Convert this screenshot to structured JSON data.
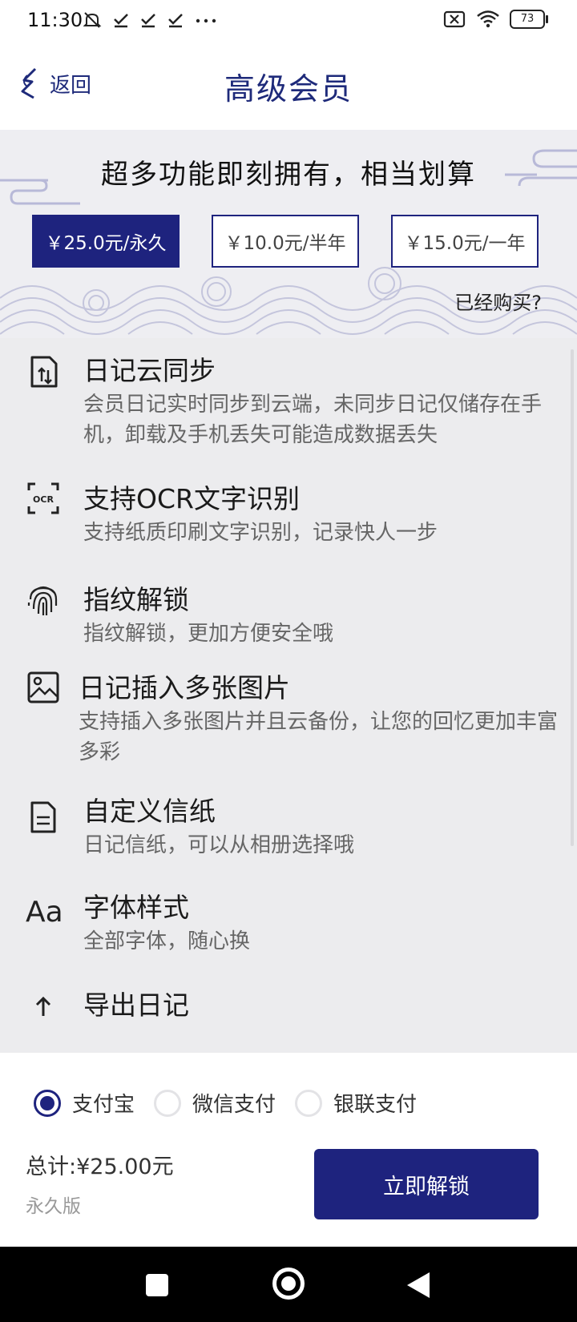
{
  "status_bar": {
    "time": "11:30",
    "battery": "73"
  },
  "header": {
    "back_label": "返回",
    "title": "高级会员"
  },
  "hero": {
    "title": "超多功能即刻拥有，相当划算",
    "already_bought": "已经购买?"
  },
  "plans": [
    {
      "label": "￥25.0元/永久",
      "selected": true
    },
    {
      "label": "￥10.0元/半年",
      "selected": false
    },
    {
      "label": "￥15.0元/一年",
      "selected": false
    }
  ],
  "features": [
    {
      "icon": "cloud-sync-icon",
      "title": "日记云同步",
      "desc": "会员日记实时同步到云端，未同步日记仅储存在手机，卸载及手机丢失可能造成数据丢失"
    },
    {
      "icon": "ocr-icon",
      "title": "支持OCR文字识别",
      "desc": "支持纸质印刷文字识别，记录快人一步"
    },
    {
      "icon": "fingerprint-icon",
      "title": "指纹解锁",
      "desc": "指纹解锁，更加方便安全哦"
    },
    {
      "icon": "image-icon",
      "title": "日记插入多张图片",
      "desc": "支持插入多张图片并且云备份，让您的回忆更加丰富多彩"
    },
    {
      "icon": "document-icon",
      "title": "自定义信纸",
      "desc": "日记信纸，可以从相册选择哦"
    },
    {
      "icon": "font-icon",
      "title": "字体样式",
      "desc": "全部字体，随心换"
    },
    {
      "icon": "export-icon",
      "title": "导出日记",
      "desc": ""
    }
  ],
  "payment": {
    "methods": [
      {
        "label": "支付宝",
        "checked": true
      },
      {
        "label": "微信支付",
        "checked": false
      },
      {
        "label": "银联支付",
        "checked": false
      }
    ],
    "total": "总计:¥25.00元",
    "edition": "永久版",
    "unlock_label": "立即解锁"
  },
  "colors": {
    "accent": "#1e237e",
    "hero_bg": "#eeeef2",
    "features_bg": "#ececee"
  }
}
